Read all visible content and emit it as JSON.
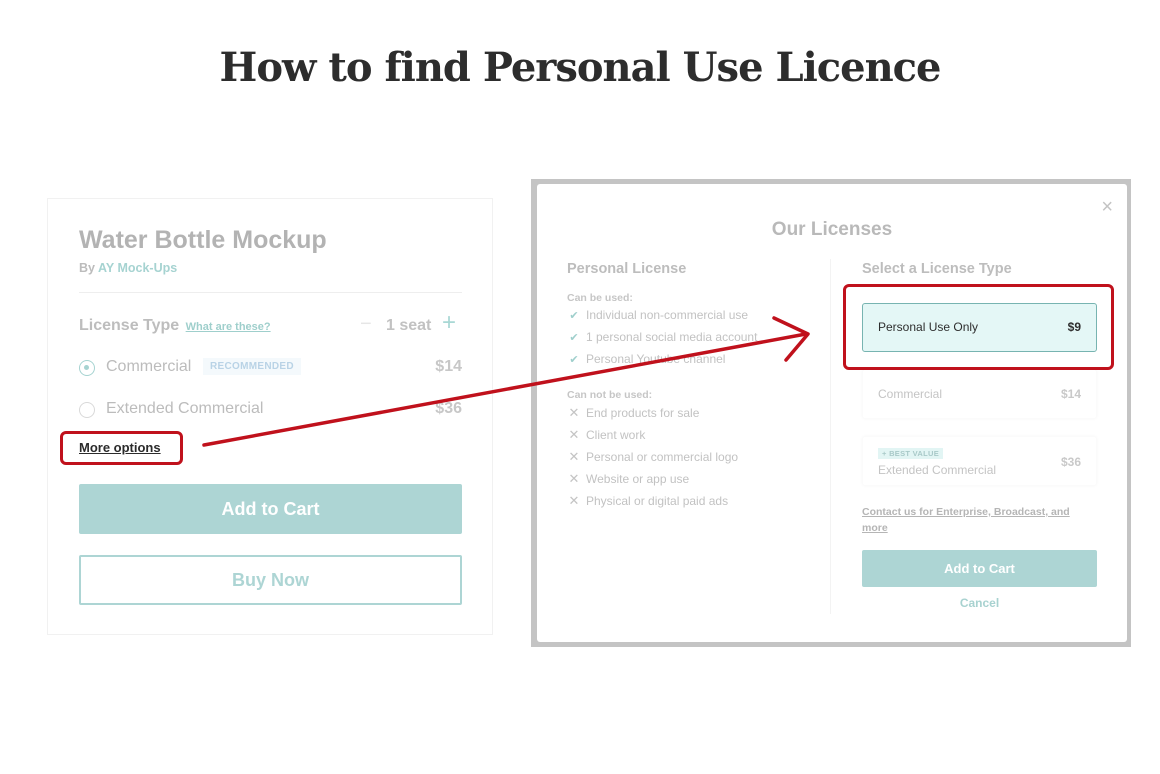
{
  "page": {
    "title": "How to find Personal Use Licence"
  },
  "product_card": {
    "title": "Water Bottle Mockup",
    "by_prefix": "By",
    "author": "AY Mock-Ups",
    "license_type_label": "License Type",
    "what_are_these_link": "What are these?",
    "seat_minus": "−",
    "seat_count": "1 seat",
    "seat_plus": "+",
    "options": [
      {
        "label": "Commercial",
        "badge": "RECOMMENDED",
        "price": "$14",
        "selected": true
      },
      {
        "label": "Extended Commercial",
        "price": "$36",
        "selected": false
      }
    ],
    "more_options_link": "More options",
    "add_to_cart": "Add to Cart",
    "buy_now": "Buy Now"
  },
  "modal": {
    "title": "Our Licenses",
    "close_icon": "×",
    "personal_license": {
      "heading": "Personal License",
      "can_be_used_label": "Can be used:",
      "can_be_used": [
        "Individual non-commercial use",
        "1 personal social media account",
        "Personal Youtube channel"
      ],
      "can_not_be_used_label": "Can not be used:",
      "can_not_be_used": [
        "End products for sale",
        "Client work",
        "Personal or commercial logo",
        "Website or app use",
        "Physical or digital paid ads"
      ],
      "check_icon": "✔",
      "cross_icon": "✕"
    },
    "select_license": {
      "heading": "Select a License Type",
      "options": [
        {
          "label": "Personal Use Only",
          "price": "$9",
          "selected": true
        },
        {
          "label": "Commercial",
          "price": "$14",
          "selected": false
        },
        {
          "label": "Extended Commercial",
          "price": "$36",
          "badge": "+ BEST VALUE",
          "selected": false
        }
      ],
      "contact_link": "Contact us for Enterprise, Broadcast, and more",
      "add_to_cart": "Add to Cart",
      "cancel": "Cancel"
    }
  },
  "colors": {
    "accent_teal": "#add5d4",
    "annotation_red": "#c0111c",
    "selected_bg": "#e4f7f6"
  }
}
